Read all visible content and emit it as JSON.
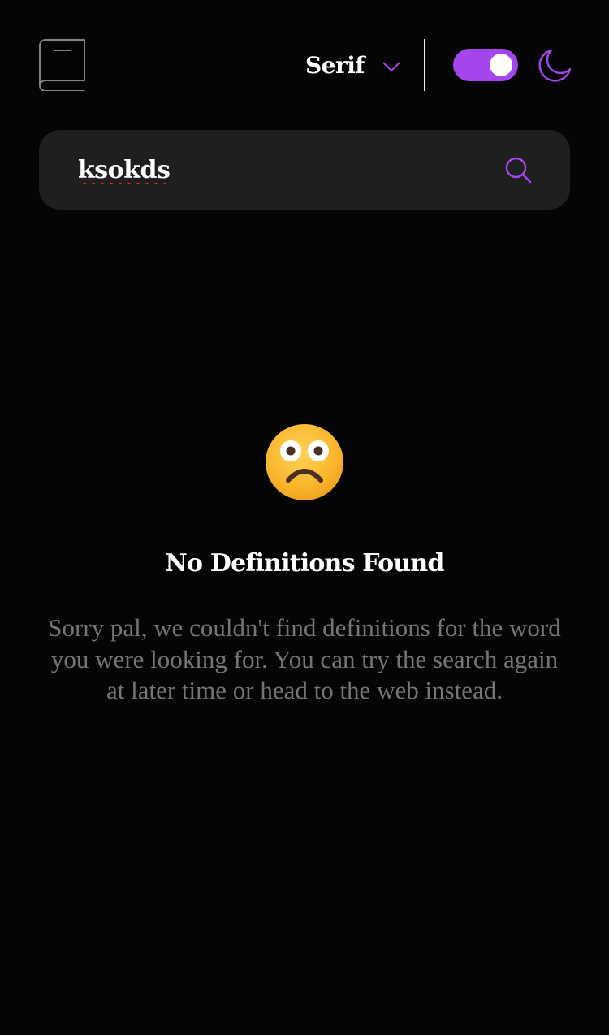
{
  "header": {
    "logo_icon": "book-icon",
    "font": {
      "selected": "Serif",
      "icon": "chevron-down-icon"
    },
    "theme_toggle": {
      "state": "on",
      "accent_color": "#a445ed"
    },
    "theme_icon": "moon-icon"
  },
  "search": {
    "value": "ksokds",
    "icon": "search-icon"
  },
  "result": {
    "emoji": "confused-face-emoji",
    "title": "No Definitions Found",
    "message": "Sorry pal, we couldn't find definitions for the word you were looking for. You can try the search again at later time or head to the web instead."
  },
  "colors": {
    "background": "#050505",
    "surface": "#1f1f1f",
    "accent": "#a445ed",
    "muted_text": "#757575",
    "text": "#ffffff"
  }
}
